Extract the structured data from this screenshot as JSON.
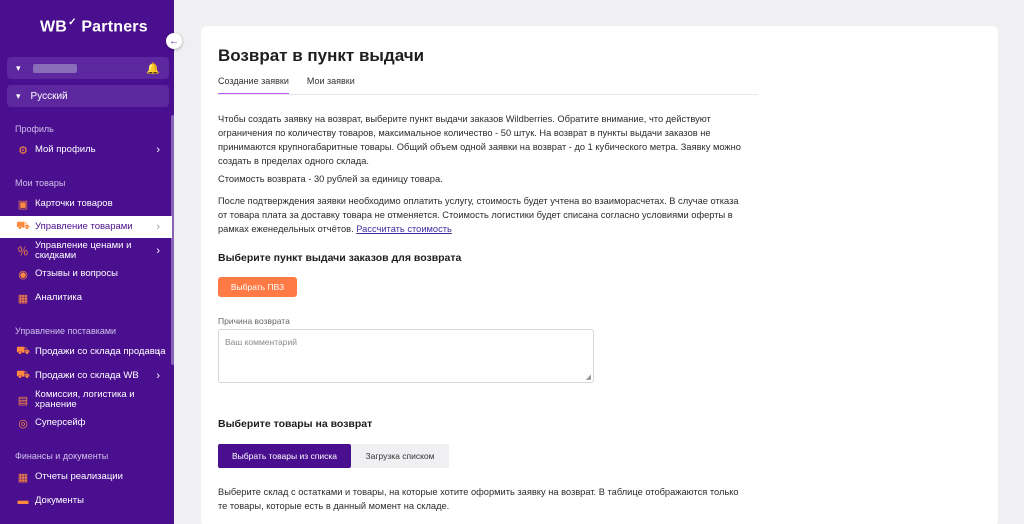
{
  "sidebar": {
    "logo": "WB",
    "logo_sup": "✓",
    "logo_text": "Partners",
    "language": "Русский",
    "sections": {
      "profile": "Профиль",
      "my_goods": "Мои товары",
      "supplies": "Управление поставками",
      "finance": "Финансы и документы"
    },
    "items": {
      "my_profile": "Мой профиль",
      "product_cards": "Карточки товаров",
      "goods_management": "Управление товарами",
      "price_management": "Управление ценами и скидками",
      "reviews": "Отзывы и вопросы",
      "analytics": "Аналитика",
      "seller_warehouse_sales": "Продажи со склада продавца",
      "wb_warehouse_sales": "Продажи со склада WB",
      "commission": "Комиссия, логистика и хранение",
      "supersafe": "Суперсейф",
      "sales_reports": "Отчеты реализации",
      "documents": "Документы"
    }
  },
  "main": {
    "title": "Возврат в пункт выдачи",
    "tabs": [
      "Создание заявки",
      "Мои заявки"
    ],
    "para1": "Чтобы создать заявку на возврат, выберите пункт выдачи заказов Wildberries. Обратите внимание, что действуют ограничения по количеству товаров, максимальное количество - 50 штук. На возврат в пункты выдачи заказов не принимаются крупногабаритные товары. Общий объем одной заявки на возврат - до 1 кубического метра. Заявку можно создать в пределах одного склада.",
    "para2": "Стоимость возврата - 30 рублей за единицу товара.",
    "para3": "После подтверждения заявки необходимо оплатить услугу, стоимость будет учтена во взаиморасчетах. В случае отказа от товара плата за доставку товара не отменяется. Стоимость логистики будет списана согласно условиями оферты в рамках еженедельных отчётов.",
    "calc_link": "Рассчитать стоимость",
    "pvz_heading": "Выберите пункт выдачи заказов для возврата",
    "pvz_button": "Выбрать ПВЗ",
    "reason_label": "Причина возврата",
    "comment_placeholder": "Ваш комментарий",
    "goods_heading": "Выберите товары на возврат",
    "choose_from_list": "Выбрать товары из списка",
    "upload_list": "Загрузка списком",
    "para4": "Выберите склад с остатками и товары, на которые хотите оформить заявку на возврат. В таблице отображаются только те товары, которые есть в данный момент на складе."
  },
  "colors": {
    "sidebar_bg": "#4a0f8f",
    "accent_orange": "#ff7a45",
    "tab_underline": "#bf5cf0"
  }
}
